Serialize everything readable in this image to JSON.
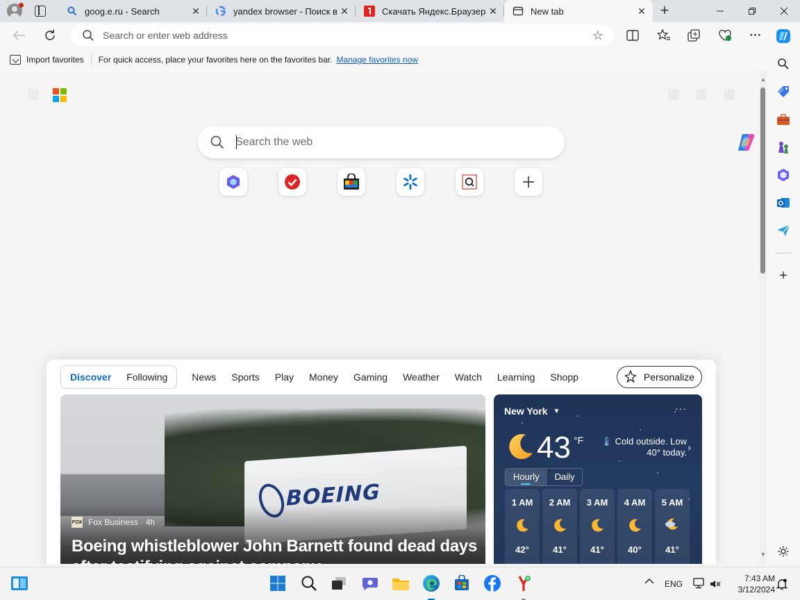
{
  "tabs": [
    {
      "title": "goog.e.ru - Search",
      "favicon": "search-favicon",
      "active": false
    },
    {
      "title": "yandex browser - Поиск в Google",
      "favicon": "google-favicon",
      "active": false
    },
    {
      "title": "Скачать Яндекс.Браузер",
      "favicon": "yandex-favicon",
      "active": false
    },
    {
      "title": "New tab",
      "favicon": "newtab-favicon",
      "active": true
    }
  ],
  "toolbar": {
    "address_placeholder": "Search or enter web address"
  },
  "favorites_bar": {
    "import_label": "Import favorites",
    "message": "For quick access, place your favorites here on the favorites bar.",
    "manage_link": "Manage favorites now"
  },
  "newtab": {
    "search_placeholder": "Search the web",
    "quick_links": [
      "microsoft-365",
      "todoist-check",
      "shopping-bag",
      "walmart",
      "search-q",
      "add-shortcut"
    ]
  },
  "feed": {
    "nav": [
      "Discover",
      "Following",
      "News",
      "Sports",
      "Play",
      "Money",
      "Gaming",
      "Weather",
      "Watch",
      "Learning",
      "Shopp"
    ],
    "active_nav": "Discover",
    "personalize_label": "Personalize",
    "hero": {
      "source": "Fox Business · 4h",
      "source_logo": "FOX",
      "headline": "Boeing whistleblower John Barnett found dead days after testifying against company",
      "sign_text": "BOEING"
    },
    "weather": {
      "location": "New York",
      "temperature": "43",
      "unit": "°F",
      "condition": "Cold outside. Low 40° today.",
      "tabs": [
        "Hourly",
        "Daily"
      ],
      "hours": [
        {
          "time": "1 AM",
          "temp": "42°",
          "icon": "moon-icon"
        },
        {
          "time": "2 AM",
          "temp": "41°",
          "icon": "moon-icon"
        },
        {
          "time": "3 AM",
          "temp": "41°",
          "icon": "moon-icon"
        },
        {
          "time": "4 AM",
          "temp": "40°",
          "icon": "moon-icon"
        },
        {
          "time": "5 AM",
          "temp": "41°",
          "icon": "cloudy-moon-icon"
        }
      ]
    }
  },
  "taskbar": {
    "language": "ENG",
    "time": "7:43 AM",
    "date": "3/12/2024"
  },
  "colors": {
    "accent": "#0f6cbd",
    "weather_bg": "#1f3557",
    "link": "#0f5bbd"
  }
}
